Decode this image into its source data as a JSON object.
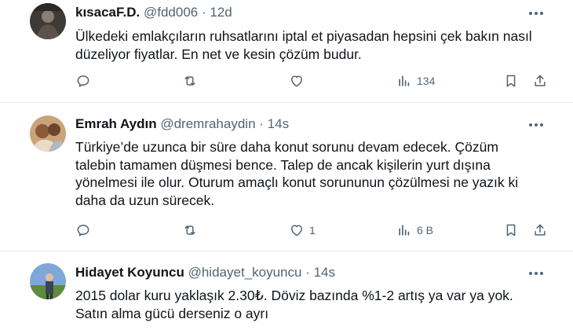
{
  "tweets": [
    {
      "name": "kısacaF.D.",
      "handle": "@fdd006",
      "dot": "·",
      "time": "12d",
      "lines": [
        "Ülkedeki emlakçıların ruhsatlarını iptal et piyasadan hepsini çek bakın nasıl",
        "düzeliyor fiyatlar. En net ve kesin çözüm budur."
      ],
      "counts": {
        "reply": "",
        "retweet": "",
        "like": "",
        "views": "134"
      }
    },
    {
      "name": "Emrah Aydın",
      "handle": "@dremrahaydin",
      "dot": "·",
      "time": "14s",
      "lines": [
        "Türkiye’de uzunca bir süre daha konut sorunu devam edecek. Çözüm",
        "talebin tamamen düşmesi bence. Talep de ancak kişilerin yurt dışına",
        "yönelmesi ile olur. Oturum amaçlı konut sorununun çözülmesi ne yazık ki",
        "daha da uzun sürecek."
      ],
      "counts": {
        "reply": "",
        "retweet": "",
        "like": "1",
        "views": "6 B"
      }
    },
    {
      "name": "Hidayet Koyuncu",
      "handle": "@hidayet_koyuncu",
      "dot": "·",
      "time": "14s",
      "lines": [
        "2015 dolar kuru yaklaşık 2.30₺. Döviz bazında %1-2 artış ya var ya yok.",
        "Satın alma gücü derseniz o ayrı"
      ],
      "counts": {
        "reply": "",
        "retweet": "",
        "like": "",
        "views": ""
      }
    }
  ],
  "icons": {
    "reply": "reply-icon",
    "retweet": "retweet-icon",
    "like": "like-icon",
    "views": "views-icon",
    "bookmark": "bookmark-icon",
    "share": "share-icon",
    "more": "more-icon"
  },
  "colors": {
    "text": "#0f1419",
    "secondary": "#536471",
    "divider": "#e6e9eb"
  }
}
